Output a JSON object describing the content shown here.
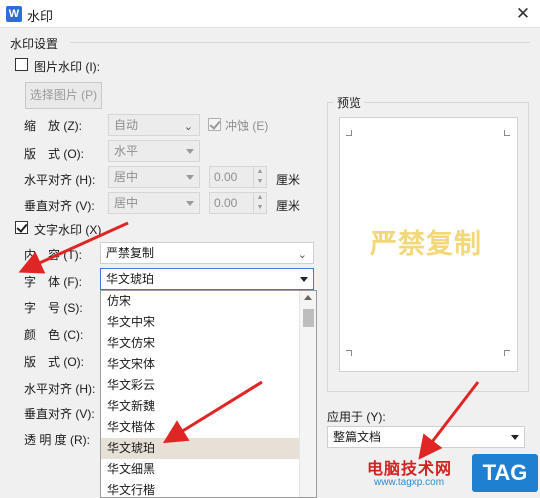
{
  "window": {
    "title": "水印",
    "app_icon": "W"
  },
  "section": {
    "title": "水印设置"
  },
  "picture_watermark": {
    "checkbox_label": "图片水印 (I):",
    "checked": false,
    "select_button": "选择图片 (P)",
    "scale_label": "缩　放 (Z):",
    "scale_value": "自动",
    "washout_label": "冲蚀 (E)",
    "washout_checked": true,
    "layout_label": "版　式 (O):",
    "layout_value": "水平",
    "halign_label": "水平对齐 (H):",
    "halign_value": "居中",
    "halign_offset": "0.00",
    "valign_label": "垂直对齐 (V):",
    "valign_value": "居中",
    "valign_offset": "0.00",
    "unit": "厘米"
  },
  "text_watermark": {
    "checkbox_label": "文字水印 (X)",
    "checked": true,
    "content_label": "内　容 (T):",
    "content_value": "严禁复制",
    "font_label": "字　体 (F):",
    "font_value": "华文琥珀",
    "size_label": "字　号 (S):",
    "color_label": "颜　色 (C):",
    "layout_label": "版　式 (O):",
    "halign_label": "水平对齐 (H):",
    "valign_label": "垂直对齐 (V):",
    "transparency_label": "透 明 度 (R):"
  },
  "font_dropdown": {
    "options": [
      "仿宋",
      "华文中宋",
      "华文仿宋",
      "华文宋体",
      "华文彩云",
      "华文新魏",
      "华文楷体",
      "华文琥珀",
      "华文细黑",
      "华文行楷"
    ],
    "selected": "华文琥珀"
  },
  "preview": {
    "title": "预览",
    "watermark_text": "严禁复制",
    "watermark_color": "#f3d77b"
  },
  "apply": {
    "label": "应用于 (Y):",
    "value": "整篇文档"
  },
  "overlay_logo": {
    "text": "电脑技术网",
    "url": "www.tagxp.com",
    "tag": "TAG"
  },
  "colors": {
    "annotation_arrow": "#e02525",
    "accent": "#3a7bd5"
  }
}
